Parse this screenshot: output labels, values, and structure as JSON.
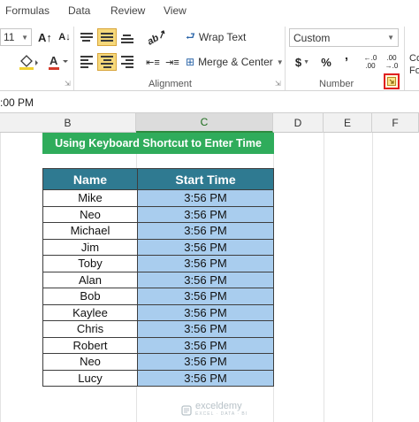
{
  "menu": {
    "tabs": [
      "Formulas",
      "Data",
      "Review",
      "View"
    ]
  },
  "font": {
    "size": "11",
    "grow_icon": "A↑",
    "shrink_icon": "A↓"
  },
  "alignment": {
    "wrap_text_label": "Wrap Text",
    "merge_center_label": "Merge & Center",
    "group_label": "Alignment"
  },
  "number": {
    "format_value": "Custom",
    "currency_symbol": "$",
    "percent_symbol": "%",
    "comma_symbol": "’",
    "increase_decimal": "←.0\n.00",
    "decrease_decimal": ".00\n→.0",
    "group_label": "Number"
  },
  "styles": {
    "partial_label_1": "Co",
    "partial_label_2": "Fo"
  },
  "formula_bar": {
    "value": ":00 PM"
  },
  "columns": [
    "B",
    "C",
    "D",
    "E",
    "F"
  ],
  "sheet": {
    "title": "Using Keyboard Shortcut to Enter Time",
    "headers": [
      "Name",
      "Start Time"
    ],
    "rows": [
      {
        "name": "Mike",
        "time": "3:56 PM"
      },
      {
        "name": "Neo",
        "time": "3:56 PM"
      },
      {
        "name": "Michael",
        "time": "3:56 PM"
      },
      {
        "name": "Jim",
        "time": "3:56 PM"
      },
      {
        "name": "Toby",
        "time": "3:56 PM"
      },
      {
        "name": "Alan",
        "time": "3:56 PM"
      },
      {
        "name": "Bob",
        "time": "3:56 PM"
      },
      {
        "name": "Kaylee",
        "time": "3:56 PM"
      },
      {
        "name": "Chris",
        "time": "3:56 PM"
      },
      {
        "name": "Robert",
        "time": "3:56 PM"
      },
      {
        "name": "Neo",
        "time": "3:56 PM"
      },
      {
        "name": "Lucy",
        "time": "3:56 PM"
      }
    ]
  },
  "watermark": {
    "brand": "exceldemy",
    "tagline": "EXCEL · DATA · BI"
  },
  "colors": {
    "title_fill": "#2fac5b",
    "header_fill": "#2f7a91",
    "selection_fill": "#a9cdee",
    "launcher_highlight": "#e02020"
  }
}
